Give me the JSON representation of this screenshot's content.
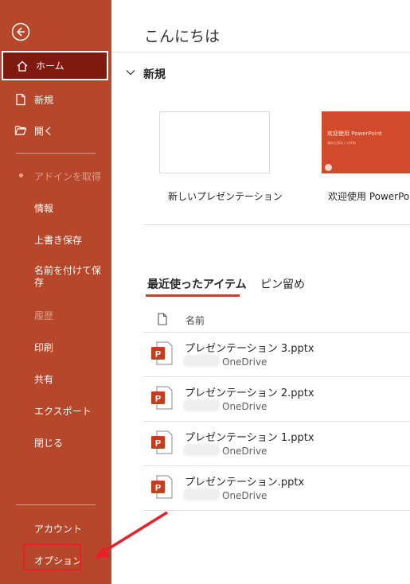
{
  "sidebar": {
    "home": "ホーム",
    "new": "新規",
    "open": "開く",
    "get_addins": "アドインを取得",
    "info": "情報",
    "save": "上書き保存",
    "save_as": "名前を付けて保存",
    "history": "履歴",
    "print": "印刷",
    "share": "共有",
    "export": "エクスポート",
    "close": "閉じる",
    "account": "アカウント",
    "options": "オプション"
  },
  "main": {
    "greeting": "こんにちは",
    "new_section": "新規",
    "templates": [
      {
        "label": "新しいプレゼンテーション"
      },
      {
        "label": "欢迎使用 PowerPo",
        "thumb_title": "欢迎使用 PowerPoint",
        "thumb_sub": "请向左滑动 (→)开始"
      }
    ],
    "tabs": {
      "recent": "最近使ったアイテム",
      "pinned": "ピン留め"
    },
    "column_name": "名前",
    "files": [
      {
        "name": "プレゼンテーション 3.pptx",
        "location": "OneDrive"
      },
      {
        "name": "プレゼンテーション 2.pptx",
        "location": "OneDrive"
      },
      {
        "name": "プレゼンテーション 1.pptx",
        "location": "OneDrive"
      },
      {
        "name": "プレゼンテーション.pptx",
        "location": "OneDrive"
      }
    ]
  },
  "colors": {
    "sidebar": "#b7472a",
    "active": "#7e1a10",
    "accent_red": "#e8202a"
  }
}
